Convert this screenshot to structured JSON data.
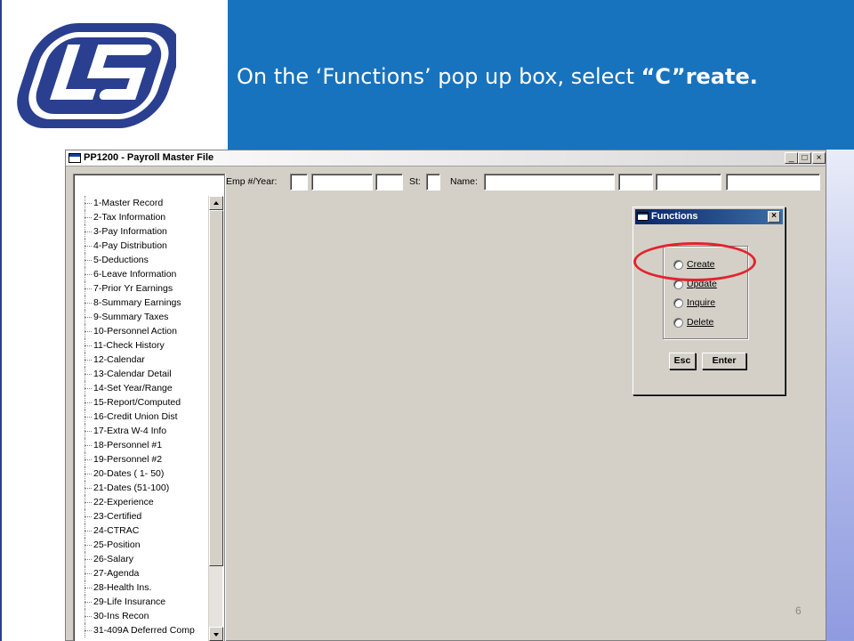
{
  "slide": {
    "title_prefix": "On the ‘Functions’ pop up box, select ",
    "title_bold": "“C”reate.",
    "page_number": "6",
    "logo_icon": "ls-logo-icon",
    "banner_color": "#1873be"
  },
  "window": {
    "title": "PP1200 - Payroll Master File",
    "minimize_label": "_",
    "restore_label": "□",
    "close_label": "×"
  },
  "fields": {
    "emp_year_label": "Emp #/Year:",
    "st_label": "St:",
    "name_label": "Name:",
    "emp_value": "",
    "year_value": "",
    "st_value": "",
    "name_value": ""
  },
  "tree": {
    "items": [
      "1-Master Record",
      "2-Tax Information",
      "3-Pay Information",
      "4-Pay Distribution",
      "5-Deductions",
      "6-Leave Information",
      "7-Prior Yr Earnings",
      "8-Summary Earnings",
      "9-Summary Taxes",
      "10-Personnel Action",
      "11-Check History",
      "12-Calendar",
      "13-Calendar Detail",
      "14-Set Year/Range",
      "15-Report/Computed",
      "16-Credit Union Dist",
      "17-Extra W-4 Info",
      "18-Personnel #1",
      "19-Personnel #2",
      "20-Dates ( 1- 50)",
      "21-Dates (51-100)",
      "22-Experience",
      "23-Certified",
      "24-CTRAC",
      "25-Position",
      "26-Salary",
      "27-Agenda",
      "28-Health Ins.",
      "29-Life Insurance",
      "30-Ins Recon",
      "31-409A Deferred Comp"
    ]
  },
  "dialog": {
    "title": "Functions",
    "close_label": "×",
    "options": [
      "Create",
      "Update",
      "Inquire",
      "Delete"
    ],
    "esc_label": "Esc",
    "enter_label": "Enter",
    "highlight_color": "#e3232c"
  }
}
